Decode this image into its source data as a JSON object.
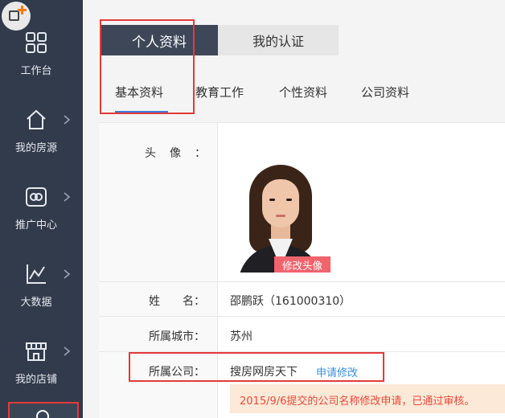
{
  "sidebar": {
    "items": [
      {
        "label": "工作台",
        "icon": "grid-icon"
      },
      {
        "label": "我的房源",
        "icon": "home-icon"
      },
      {
        "label": "推广中心",
        "icon": "promotion-icon"
      },
      {
        "label": "大数据",
        "icon": "chart-icon"
      },
      {
        "label": "我的店铺",
        "icon": "store-icon"
      }
    ]
  },
  "tabs": {
    "profile": "个人资料",
    "certification": "我的认证"
  },
  "subtabs": [
    "基本资料",
    "教育工作",
    "个性资料",
    "公司资料"
  ],
  "profile": {
    "avatar_label": "头像：",
    "edit_avatar": "修改头像",
    "name_label": "姓　　名：",
    "name_value": "邵鹏跃（161000310）",
    "city_label": "所属城市：",
    "city_value": "苏州",
    "company_label": "所属公司：",
    "company_value": "搜房网房天下",
    "apply_edit": "申请修改",
    "notice": "2015/9/6提交的公司名称修改申请，已通过审核。"
  },
  "colors": {
    "sidebar_bg": "#313b4c",
    "active_tab": "#3d4758",
    "accent_red": "#e43a3a",
    "link_blue": "#3a8ed8",
    "notice_bg": "#fde9d8",
    "notice_text": "#e34b3a"
  }
}
